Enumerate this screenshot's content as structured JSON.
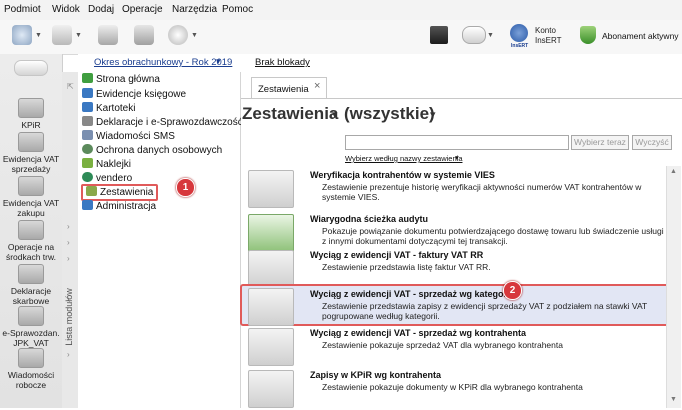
{
  "menu": [
    "Podmiot",
    "Widok",
    "Dodaj",
    "Operacje",
    "Narzędzia",
    "Pomoc"
  ],
  "toolbar": {
    "account_line1": "Konto",
    "account_line2": "InsERT",
    "insert_small": "InsERT",
    "subscription": "Abonament aktywny"
  },
  "subbar": {
    "period": "Okres obrachunkowy - Rok 2019",
    "period_caret": "▾",
    "missing_locks": "Brak blokady"
  },
  "modules": [
    {
      "label": "KPiR"
    },
    {
      "label": "Ewidencja VAT\nsprzedaży"
    },
    {
      "label": "Ewidencja VAT\nzakupu"
    },
    {
      "label": "Operacje na\nśrodkach trw."
    },
    {
      "label": "Deklaracje\nskarbowe"
    },
    {
      "label": "e-Sprawozdan.\nJPK_VAT"
    },
    {
      "label": "Wiadomości\nrobocze"
    }
  ],
  "strip_label": "Lista modułów",
  "tree": [
    {
      "label": "Strona główna",
      "icon_color": "#3f9e3f"
    },
    {
      "label": "Ewidencje księgowe",
      "icon_color": "#3a78c2"
    },
    {
      "label": "Kartoteki",
      "icon_color": "#3a78c2"
    },
    {
      "label": "Deklaracje i e-Sprawozdawczość",
      "icon_color": "#888888"
    },
    {
      "label": "Wiadomości SMS",
      "icon_color": "#7a8fb0"
    },
    {
      "label": "Ochrona danych osobowych",
      "icon_color": "#5c8a5c"
    },
    {
      "label": "Naklejki",
      "icon_color": "#7ab040"
    },
    {
      "label": "vendero",
      "icon_color": "#2e8b57"
    },
    {
      "label": "Zestawienia",
      "icon_color": "#8aa84a"
    },
    {
      "label": "Administracja",
      "icon_color": "#3a78c2"
    }
  ],
  "badges": {
    "tree": "1",
    "list": "2"
  },
  "tab": {
    "label": "Zestawienia",
    "close": "×"
  },
  "heading": {
    "left": "Zestawienia",
    "right": "(wszystkie)",
    "caret": "▾"
  },
  "search": {
    "value": "",
    "search_btn": "Wybierz teraz",
    "clear_btn": "Wyczyść",
    "hint": "Wybierz według nazwy zestawienia",
    "hint_caret": "▾"
  },
  "items": [
    {
      "title": "Weryfikacja kontrahentów w systemie VIES",
      "desc": "Zestawienie prezentuje historię weryfikacji aktywności numerów VAT kontrahentów w systemie VIES."
    },
    {
      "title": "Wiarygodna ścieżka audytu",
      "desc": "Pokazuje powiązanie dokumentu potwierdzającego dostawę towaru lub świadczenie usługi z innymi dokumentami dotyczącymi tej transakcji."
    },
    {
      "title": "Wyciąg z ewidencji VAT - faktury VAT RR",
      "desc": "Zestawienie przedstawia listę faktur VAT RR."
    },
    {
      "title": "Wyciąg z ewidencji VAT - sprzedaż wg kategorii",
      "desc": "Zestawienie przedstawia zapisy z ewidencji sprzedaży VAT z podziałem na stawki VAT pogrupowane według kategorii."
    },
    {
      "title": "Wyciąg z ewidencji VAT - sprzedaż wg kontrahenta",
      "desc": "Zestawienie pokazuje sprzedaż VAT dla wybranego kontrahenta"
    },
    {
      "title": "Zapisy w KPiR wg kontrahenta",
      "desc": "Zestawienie pokazuje dokumenty w KPiR dla wybranego kontrahenta"
    }
  ],
  "colors": {
    "accent_red": "#e05a5a",
    "selection_bg": "#e2e6f4",
    "link_blue": "#1a3d8f"
  }
}
